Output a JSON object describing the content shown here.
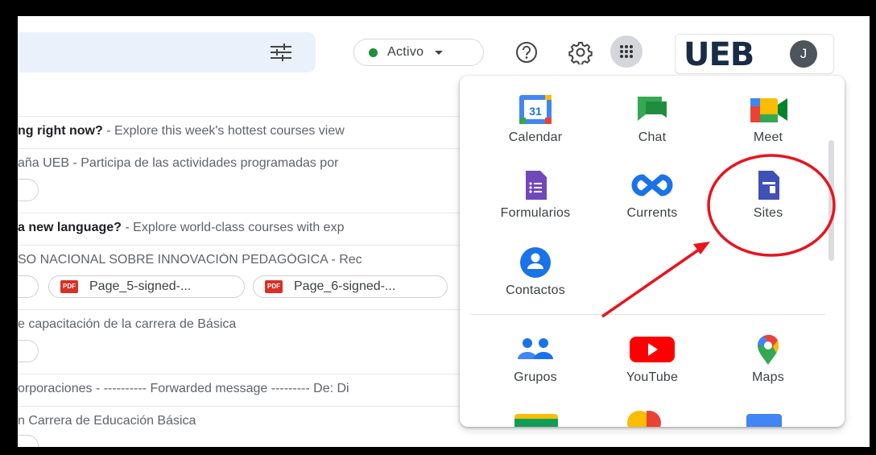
{
  "topbar": {
    "status_label": "Activo",
    "brand_text": "UEB",
    "avatar_initial": "J",
    "icons": [
      "tune-icon",
      "help-icon",
      "gear-icon",
      "apps-grid-icon"
    ]
  },
  "emails": [
    {
      "subject": "ng right now?",
      "snippet": " - Explore this week's hottest courses view"
    },
    {
      "subject": "",
      "snippet": "aña UEB - Participa de las actividades programadas por"
    },
    {
      "subject": "a new language?",
      "snippet": " - Explore world-class courses with exp"
    },
    {
      "subject": "",
      "snippet": "SO NACIONAL SOBRE INNOVACIÓN PEDAGÓGICA - Rec"
    },
    {
      "subject": "",
      "snippet": "e capacitación de la carrera de Básica"
    },
    {
      "subject": "",
      "snippet": "orporaciones - ---------- Forwarded message --------- De: Di"
    },
    {
      "subject": "",
      "snippet": "n Carrera de Educación Básica"
    }
  ],
  "attachments": [
    "Page_5-signed-...",
    "Page_6-signed-..."
  ],
  "attachment_type": "PDF",
  "apps": [
    {
      "label": "Calendar",
      "icon": "calendar-icon",
      "calendar_day": "31"
    },
    {
      "label": "Chat",
      "icon": "chat-icon"
    },
    {
      "label": "Meet",
      "icon": "meet-icon"
    },
    {
      "label": "Formularios",
      "icon": "forms-icon"
    },
    {
      "label": "Currents",
      "icon": "currents-icon"
    },
    {
      "label": "Sites",
      "icon": "sites-icon"
    },
    {
      "label": "Contactos",
      "icon": "contacts-icon"
    },
    {
      "label": "Grupos",
      "icon": "groups-icon"
    },
    {
      "label": "YouTube",
      "icon": "youtube-icon"
    },
    {
      "label": "Maps",
      "icon": "maps-icon"
    }
  ],
  "colors": {
    "annotation": "#e8141e",
    "brand_navy": "#1a2b46",
    "active_green": "#1e8e3e"
  }
}
